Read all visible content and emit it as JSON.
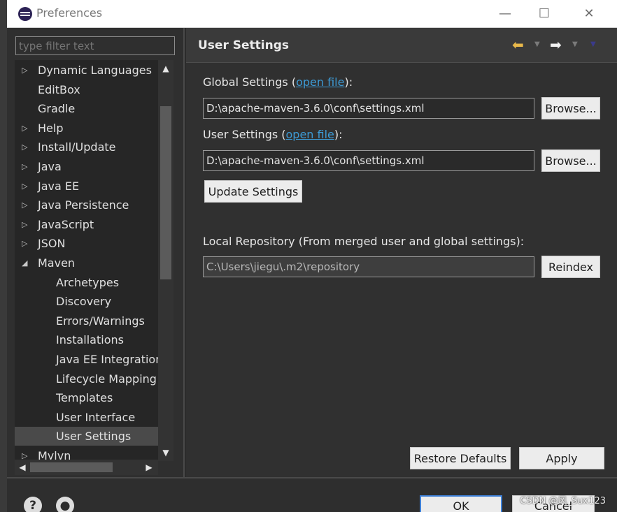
{
  "window": {
    "title": "Preferences",
    "minimize": "—",
    "maximize": "☐",
    "close": "✕"
  },
  "sidebar": {
    "filter_placeholder": "type filter text",
    "items": [
      {
        "label": "Dynamic Languages",
        "expandable": true
      },
      {
        "label": "EditBox",
        "expandable": false
      },
      {
        "label": "Gradle",
        "expandable": false
      },
      {
        "label": "Help",
        "expandable": true
      },
      {
        "label": "Install/Update",
        "expandable": true
      },
      {
        "label": "Java",
        "expandable": true
      },
      {
        "label": "Java EE",
        "expandable": true
      },
      {
        "label": "Java Persistence",
        "expandable": true
      },
      {
        "label": "JavaScript",
        "expandable": true
      },
      {
        "label": "JSON",
        "expandable": true
      },
      {
        "label": "Maven",
        "expandable": true,
        "expanded": true
      },
      {
        "label": "Archetypes",
        "child": true
      },
      {
        "label": "Discovery",
        "child": true
      },
      {
        "label": "Errors/Warnings",
        "child": true
      },
      {
        "label": "Installations",
        "child": true
      },
      {
        "label": "Java EE Integration",
        "child": true
      },
      {
        "label": "Lifecycle Mapping",
        "child": true
      },
      {
        "label": "Templates",
        "child": true
      },
      {
        "label": "User Interface",
        "child": true
      },
      {
        "label": "User Settings",
        "child": true,
        "selected": true
      },
      {
        "label": "Mylyn",
        "expandable": true
      }
    ]
  },
  "main": {
    "title": "User Settings",
    "global_settings_label": "Global Settings",
    "global_open_file": "open file",
    "global_settings_value": "D:\\apache-maven-3.6.0\\conf\\settings.xml",
    "user_settings_label": "User Settings",
    "user_open_file": "open file",
    "user_settings_value": "D:\\apache-maven-3.6.0\\conf\\settings.xml",
    "browse_label": "Browse...",
    "update_settings_label": "Update Settings",
    "local_repo_label": "Local Repository (From merged user and global settings):",
    "local_repo_value": "C:\\Users\\jiegu\\.m2\\repository",
    "reindex_label": "Reindex",
    "restore_defaults_label": "Restore Defaults",
    "apply_label": "Apply"
  },
  "footer": {
    "ok_label": "OK",
    "cancel_label": "Cancel",
    "watermark": "CSDN @风_Sux123"
  },
  "colors": {
    "accent_link": "#3d9bd6",
    "back_arrow": "#e8b84a",
    "selected_row": "#4a4a4a"
  }
}
